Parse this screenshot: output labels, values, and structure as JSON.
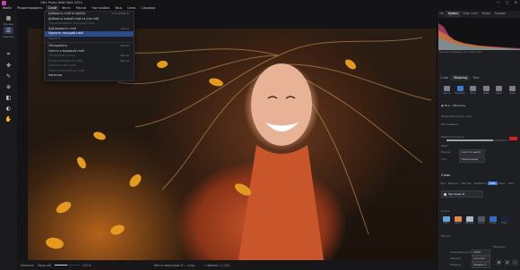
{
  "window": {
    "title": "ON1 Photo RAW MAX 2024",
    "controls": [
      "—",
      "▢",
      "✕"
    ]
  },
  "menubar": {
    "items": [
      {
        "label": "Файл",
        "active": false
      },
      {
        "label": "Редактировать",
        "active": false
      },
      {
        "label": "Слой",
        "active": true
      },
      {
        "label": "Фото",
        "active": false
      },
      {
        "label": "Маска",
        "active": false
      },
      {
        "label": "Настройки",
        "active": false
      },
      {
        "label": "Вид",
        "active": false
      },
      {
        "label": "Окно",
        "active": false
      },
      {
        "label": "Справка",
        "active": false
      }
    ]
  },
  "left_toolbar": {
    "tools": [
      {
        "icon": "grid-icon",
        "label": "Browse"
      },
      {
        "icon": "sliders-icon",
        "label": "Develop"
      },
      {
        "icon": "crop-icon",
        "label": ""
      },
      {
        "icon": "transform-icon",
        "label": ""
      },
      {
        "icon": "brush-icon",
        "label": ""
      },
      {
        "icon": "stamp-icon",
        "label": ""
      },
      {
        "icon": "eraser-icon",
        "label": ""
      },
      {
        "icon": "gradient-icon",
        "label": ""
      },
      {
        "icon": "view-icon",
        "label": ""
      }
    ]
  },
  "layer_menu": {
    "items": [
      {
        "label": "Добавить слой из файла",
        "shortcut": "Ctrl+Shift+O",
        "state": "normal"
      },
      {
        "label": "Добавить новый слой из (пустой)",
        "shortcut": "",
        "state": "normal"
      },
      {
        "label": "Переименовать текущий слой",
        "shortcut": "",
        "state": "disabled"
      },
      {
        "label": "Дублировать слой",
        "shortcut": "Ctrl+J",
        "state": "normal"
      },
      {
        "label": "Удалить текущий слой",
        "shortcut": "",
        "state": "highlighted"
      },
      {
        "label": "Удалить",
        "shortcut": "",
        "state": "disabled"
      },
      {
        "label": "separator",
        "shortcut": "",
        "state": "separator"
      },
      {
        "label": "Объединить",
        "shortcut": "Ctrl+E",
        "state": "normal"
      },
      {
        "label": "Свести в видимый слой",
        "shortcut": "",
        "state": "normal"
      },
      {
        "label": "Объединить вниз",
        "shortcut": "Ctrl+G",
        "state": "disabled"
      },
      {
        "label": "Разгруппировать слой",
        "shortcut": "Ctrl+G",
        "state": "disabled"
      },
      {
        "label": "Показать все слои",
        "shortcut": "",
        "state": "disabled"
      },
      {
        "label": "Скрыть остальные слои",
        "shortcut": "",
        "state": "disabled"
      },
      {
        "label": "Фильтры",
        "shortcut": "",
        "state": "normal"
      }
    ]
  },
  "right_panel": {
    "top_tabs": [
      {
        "label": "На",
        "active": false
      },
      {
        "label": "Уровни",
        "active": true
      },
      {
        "label": "Инф. слоя",
        "active": false
      },
      {
        "label": "Инфо",
        "active": false
      },
      {
        "label": "Кривые",
        "active": false
      }
    ],
    "histogram_info": "Тени 12.8   Средние 23.1   Света 15.6",
    "layers_tabs": [
      {
        "label": "Слои",
        "active": false
      },
      {
        "label": "Masking",
        "active": true
      },
      {
        "label": "Text",
        "active": false
      }
    ],
    "mask_tools": [
      {
        "icon": "brush-mask-icon",
        "label": "Кисть",
        "active": false
      },
      {
        "icon": "portrait-icon",
        "label": "Портрет",
        "active": true
      },
      {
        "icon": "bg-icon",
        "label": "Фон",
        "active": false
      },
      {
        "icon": "sky-icon",
        "label": "Небо",
        "active": false
      },
      {
        "icon": "chroma-icon",
        "label": "Цвет",
        "active": false
      },
      {
        "icon": "add-icon",
        "label": "Ещё",
        "active": false
      }
    ],
    "rows": {
      "background": "Фон - Объекты",
      "layer_opacity": "Непрозрачность слоя",
      "feather": "Растушёвка",
      "mask_blend": "Размытие маски",
      "color_label": "Цвет",
      "mode_label": "Режим",
      "mode_value": "Очистка цвета",
      "type_label": "Тип",
      "type_value": "Нормальный"
    },
    "sky_section": {
      "title": "Слои",
      "subtabs": [
        {
          "label": "Все",
          "active": false
        },
        {
          "label": "Избран.",
          "active": false
        },
        {
          "label": "Мастер",
          "active": false
        },
        {
          "label": "Эффекты",
          "active": false
        },
        {
          "label": "Небо",
          "active": true
        },
        {
          "label": "Цвет",
          "active": false
        },
        {
          "label": "Свет",
          "active": false
        }
      ],
      "sky_swap_label": "Sky Swap AI",
      "section_label": "Стиль",
      "thumbs": [
        "Утро",
        "Закат",
        "Облака",
        "Гроза",
        "Синее",
        "Ночь"
      ],
      "bottom_label": "Маска",
      "preset_label": "Пресеты",
      "model_label": "Модель",
      "model_value": "Модель А",
      "row1_label": "Непрозрачность",
      "row1_value": "100%",
      "row2_label": "Облака",
      "row2_value": "Cloud 01"
    }
  },
  "statusbar": {
    "mode": "Показать",
    "zoom_label": "Масштаб",
    "zoom_value": "100 %",
    "info1": "Места навигации: 8 — отдр.",
    "info2": "1 файлов: 2 / 2/2/"
  }
}
